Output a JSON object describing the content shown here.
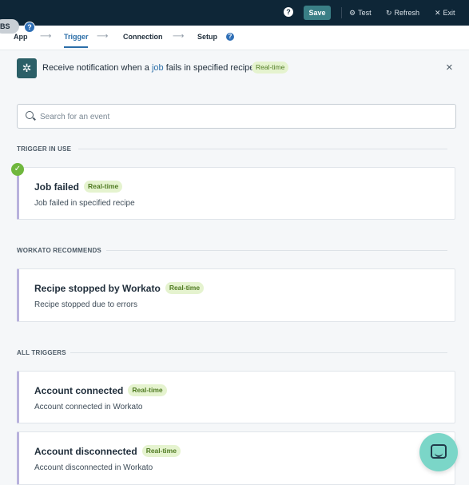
{
  "topbar": {
    "left_pill": "BS",
    "help_label": "?",
    "save_label": "Save",
    "test_label": "Test",
    "refresh_label": "Refresh",
    "exit_label": "Exit",
    "test_icon": "gear-icon",
    "refresh_icon": "refresh-icon",
    "exit_icon": "close-icon"
  },
  "steps": {
    "items": [
      {
        "label": "App"
      },
      {
        "label": "Trigger"
      },
      {
        "label": "Connection"
      },
      {
        "label": "Setup"
      }
    ],
    "active": "Trigger",
    "arrow": "⟶",
    "help_label": "?"
  },
  "trigger_header": {
    "sentence_prefix": "Receive notification when a ",
    "keyword": "job",
    "sentence_suffix": " fails in specified recipes",
    "badge": "Real-time",
    "close": "×"
  },
  "search": {
    "placeholder": "Search for an event",
    "value": ""
  },
  "sections": {
    "in_use": "TRIGGER IN USE",
    "recommends": "WORKATO RECOMMENDS",
    "all": "ALL TRIGGERS"
  },
  "cards": {
    "job_failed": {
      "title": "Job failed",
      "badge": "Real-time",
      "desc": "Job failed in specified recipe"
    },
    "recipe_stopped": {
      "title": "Recipe stopped by Workato",
      "badge": "Real-time",
      "desc": "Recipe stopped due to errors"
    },
    "account_connected": {
      "title": "Account connected",
      "badge": "Real-time",
      "desc": "Account connected in Workato"
    },
    "account_disconnected": {
      "title": "Account disconnected",
      "badge": "Real-time",
      "desc": "Account disconnected in Workato"
    }
  },
  "colors": {
    "topbar_bg": "#0e2637",
    "save_btn": "#3a7f86",
    "active_step": "#2b6ea8",
    "badge_bg": "#e5f3cf",
    "card_accent": "#b8b2dd",
    "check": "#6fb73d",
    "chat_btn": "#7bd6c8"
  }
}
